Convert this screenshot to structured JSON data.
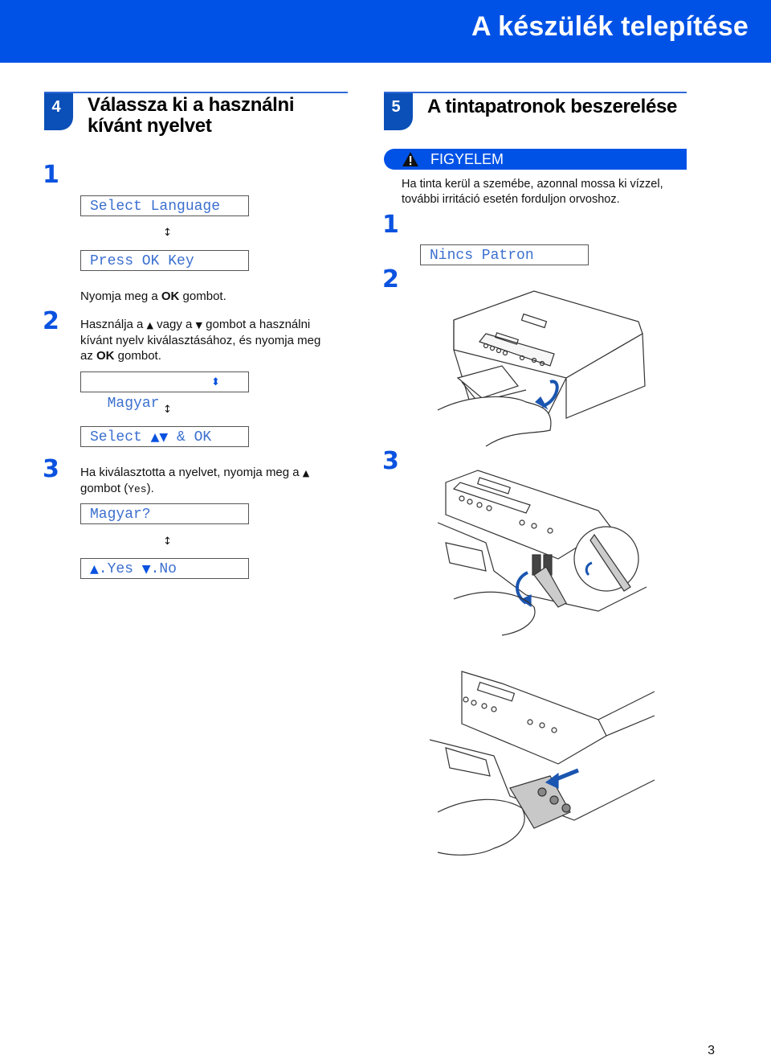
{
  "header": {
    "title": "A készülék telepítése"
  },
  "left_section": {
    "step_number": "4",
    "title_line1": "Válassza ki a használni",
    "title_line2": "kívánt nyelvet",
    "substeps": [
      {
        "number": "1",
        "lcd_1": "Select Language",
        "toggle_icon": "↕",
        "lcd_2": "Press OK Key",
        "text_before": "Nyomja meg a ",
        "text_bold": "OK",
        "text_after": " gombot."
      },
      {
        "number": "2",
        "text_1": "Használja a ",
        "up_icon": "▲",
        "text_2": " vagy a ",
        "down_icon": "▼",
        "text_3": " gombot a használni",
        "text_line2": "kívánt nyelv kiválasztásához, és nyomja meg",
        "text_line3_before": "az ",
        "text_line3_bold": "OK",
        "text_line3_after": " gombot.",
        "lcd_1": "Magyar",
        "lcd_1_icon": "⬍",
        "toggle_icon": "↕",
        "lcd_2_before": "Select ",
        "lcd_2_icon": "▲▼",
        "lcd_2_after": " & OK"
      },
      {
        "number": "3",
        "text_1": "Ha kiválasztotta a nyelvet, nyomja meg a ",
        "up_icon": "▲",
        "text_line2_before": "gombot (",
        "text_line2_mono": "Yes",
        "text_line2_after": ").",
        "lcd_1": "Magyar?",
        "toggle_icon": "↕",
        "lcd_2_up": "▲",
        "lcd_2_yes": ".Yes ",
        "lcd_2_down": "▼",
        "lcd_2_no": ".No"
      }
    ]
  },
  "right_section": {
    "step_number": "5",
    "title": "A tintapatronok beszerelése",
    "warning": {
      "label": "FIGYELEM",
      "icon": "warning-triangle",
      "text_line1": "Ha tinta kerül a szemébe, azonnal mossa ki vízzel,",
      "text_line2": "további irritáció esetén forduljon orvoshoz."
    },
    "substeps": [
      {
        "number": "1"
      },
      {
        "number": "2",
        "lcd": "Nincs Patron",
        "illustration": "open-scanner-cover"
      },
      {
        "number": "3",
        "illustrations": [
          "release-lock-lever",
          "remove-protective-part"
        ]
      }
    ]
  },
  "colors": {
    "brand_blue": "#0052e6",
    "tab_blue": "#0b4fb8",
    "lcd_text": "#3b6fcf"
  },
  "footer": {
    "page_number": "3"
  }
}
